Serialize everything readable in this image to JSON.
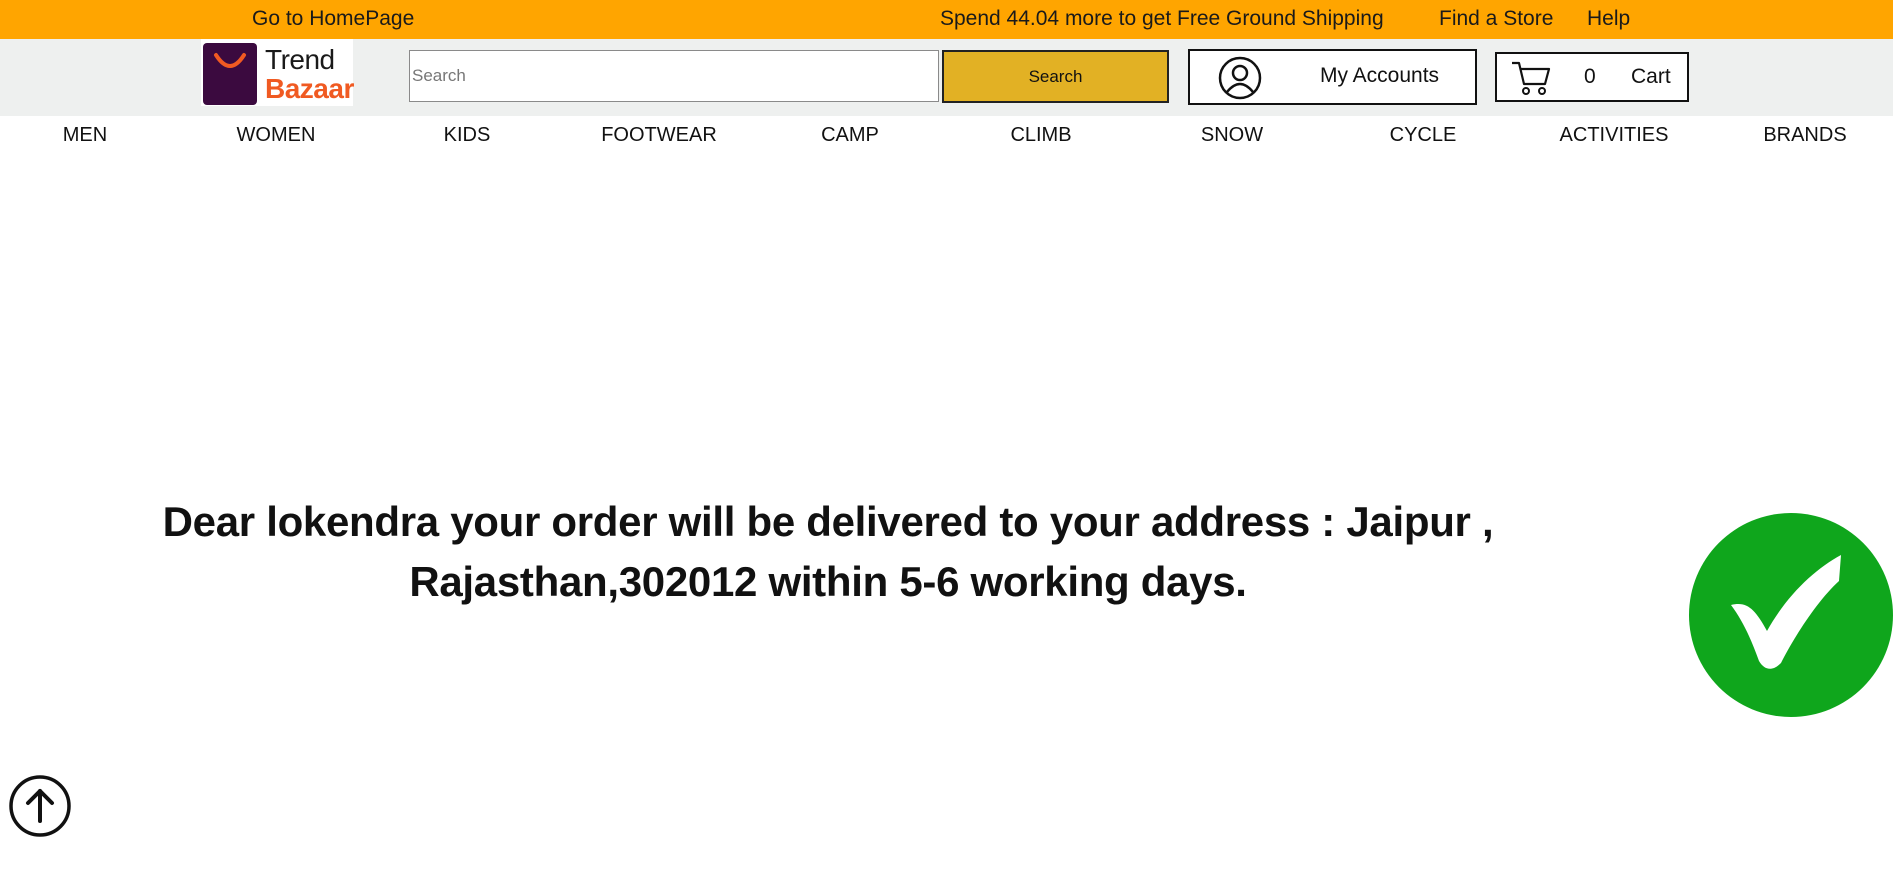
{
  "topbar": {
    "home_link": "Go to HomePage",
    "shipping_message": "Spend 44.04 more to get Free Ground Shipping",
    "find_store": "Find a Store",
    "help": "Help",
    "background_color": "#ffa500"
  },
  "logo": {
    "line1": "Trend",
    "line2": "Bazaar"
  },
  "search": {
    "placeholder": "Search",
    "value": "",
    "button_label": "Search"
  },
  "account": {
    "label": "My Accounts",
    "icon": "user-circle-icon"
  },
  "cart": {
    "count": "0",
    "label": "Cart",
    "icon": "shopping-cart-icon"
  },
  "nav": {
    "items": [
      {
        "label": "MEN"
      },
      {
        "label": "WOMEN"
      },
      {
        "label": "KIDS"
      },
      {
        "label": "FOOTWEAR"
      },
      {
        "label": "CAMP"
      },
      {
        "label": "CLIMB"
      },
      {
        "label": "SNOW"
      },
      {
        "label": "CYCLE"
      },
      {
        "label": "ACTIVITIES"
      },
      {
        "label": "BRANDS"
      }
    ]
  },
  "confirmation": {
    "line1": "Dear lokendra your order will be delivered to your address : Jaipur ,",
    "line2": "Rajasthan,302012 within 5-6 working days.",
    "icon": "check-circle-icon",
    "icon_color": "#0fa61c"
  },
  "scroll_top": {
    "icon": "arrow-up-circle-icon"
  }
}
